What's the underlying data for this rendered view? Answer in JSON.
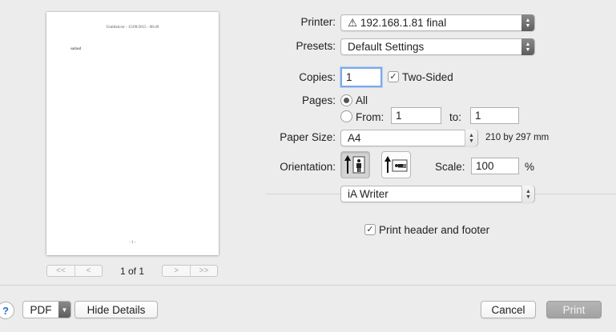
{
  "preview": {
    "header_text": "Untitled.txt - 15/09/2015 - 08:49",
    "body_text": "sadasd",
    "footer_text": "- 1 -",
    "page_count": "1 of 1",
    "nav": {
      "first": "<<",
      "prev": "<",
      "next": ">",
      "last": ">>"
    }
  },
  "printer": {
    "label": "Printer:",
    "value": "⚠ 192.168.1.81 final"
  },
  "presets": {
    "label": "Presets:",
    "value": "Default Settings"
  },
  "copies": {
    "label": "Copies:",
    "value": "1",
    "two_sided_label": "Two-Sided",
    "two_sided_checked": true
  },
  "pages": {
    "label": "Pages:",
    "all_label": "All",
    "from_label": "From:",
    "from_value": "1",
    "to_label": "to:",
    "to_value": "1"
  },
  "paper_size": {
    "label": "Paper Size:",
    "value": "A4",
    "dimensions": "210 by 297 mm"
  },
  "orientation": {
    "label": "Orientation:",
    "scale_label": "Scale:",
    "scale_value": "100",
    "percent": "%"
  },
  "app_section": {
    "value": "iA Writer"
  },
  "header_footer": {
    "label": "Print header and footer",
    "checked": true
  },
  "footer_bar": {
    "help": "?",
    "pdf": "PDF",
    "hide_details": "Hide Details",
    "cancel": "Cancel",
    "print": "Print"
  }
}
